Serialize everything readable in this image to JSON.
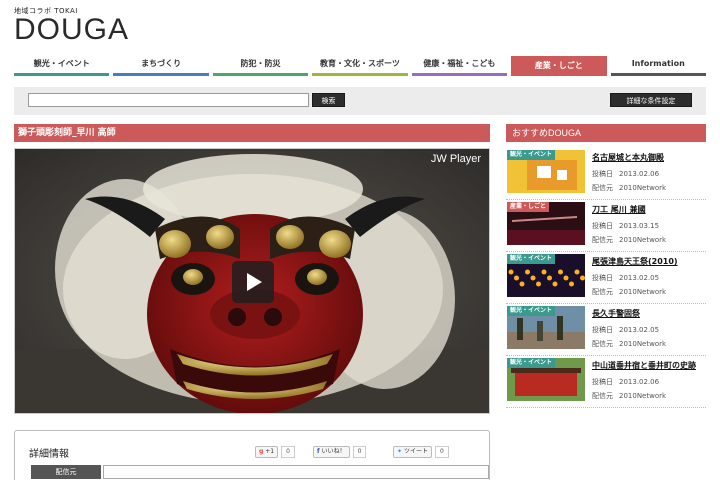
{
  "header": {
    "logo_small": "地域コラボ TOKAI",
    "logo_big": "DOUGA"
  },
  "nav": {
    "items": [
      {
        "label": "観光・イベント",
        "color": "#3a9a8e"
      },
      {
        "label": "まちづくり",
        "color": "#4a7cc0"
      },
      {
        "label": "防犯・防災",
        "color": "#49a86a"
      },
      {
        "label": "教育・文化・スポーツ",
        "color": "#a0b53a"
      },
      {
        "label": "健康・福祉・こども",
        "color": "#9a6bbd"
      },
      {
        "label": "産業・しごと",
        "color": "#cd5a5a",
        "active": true
      },
      {
        "label": "Information",
        "color": "#555555"
      }
    ]
  },
  "search": {
    "value": "",
    "button_label": "検索",
    "detail_button_label": "詳細な条件設定"
  },
  "video": {
    "title": "獅子頭彫刻師_早川 高師",
    "player_brand": "JW Player"
  },
  "details": {
    "title": "詳細情報",
    "gplus_label": "+1",
    "gplus_count": "0",
    "fb_label": "いいね！",
    "fb_count": "0",
    "tw_label": "ツイート",
    "tw_count": "0",
    "source_label": "配信元",
    "source_value": ""
  },
  "sidebar": {
    "header": "おすすめDOUGA",
    "posted_label": "投稿日",
    "source_label": "配信元",
    "items": [
      {
        "tag": "観光・イベント",
        "tag_color": "#3a9a8e",
        "title": "名古屋城と本丸御殿",
        "date": "2013.02.06",
        "source": "2010Network",
        "thumb": "castle"
      },
      {
        "tag": "産業・しごと",
        "tag_color": "#cd5a5a",
        "title": "刀工 尾川 兼國",
        "date": "2013.03.15",
        "source": "2010Network",
        "thumb": "sword"
      },
      {
        "tag": "観光・イベント",
        "tag_color": "#3a9a8e",
        "title": "尾張津島天王祭(2010)",
        "date": "2013.02.05",
        "source": "2010Network",
        "thumb": "lanterns"
      },
      {
        "tag": "観光・イベント",
        "tag_color": "#3a9a8e",
        "title": "長久手警固祭",
        "date": "2013.02.05",
        "source": "2010Network",
        "thumb": "festival"
      },
      {
        "tag": "観光・イベント",
        "tag_color": "#3a9a8e",
        "title": "中山道垂井宿と垂井町の史跡",
        "date": "2013.02.06",
        "source": "2010Network",
        "thumb": "shrine"
      }
    ]
  },
  "colors": {
    "accent": "#cd5a5a",
    "dark_button": "#2d2d2d"
  }
}
